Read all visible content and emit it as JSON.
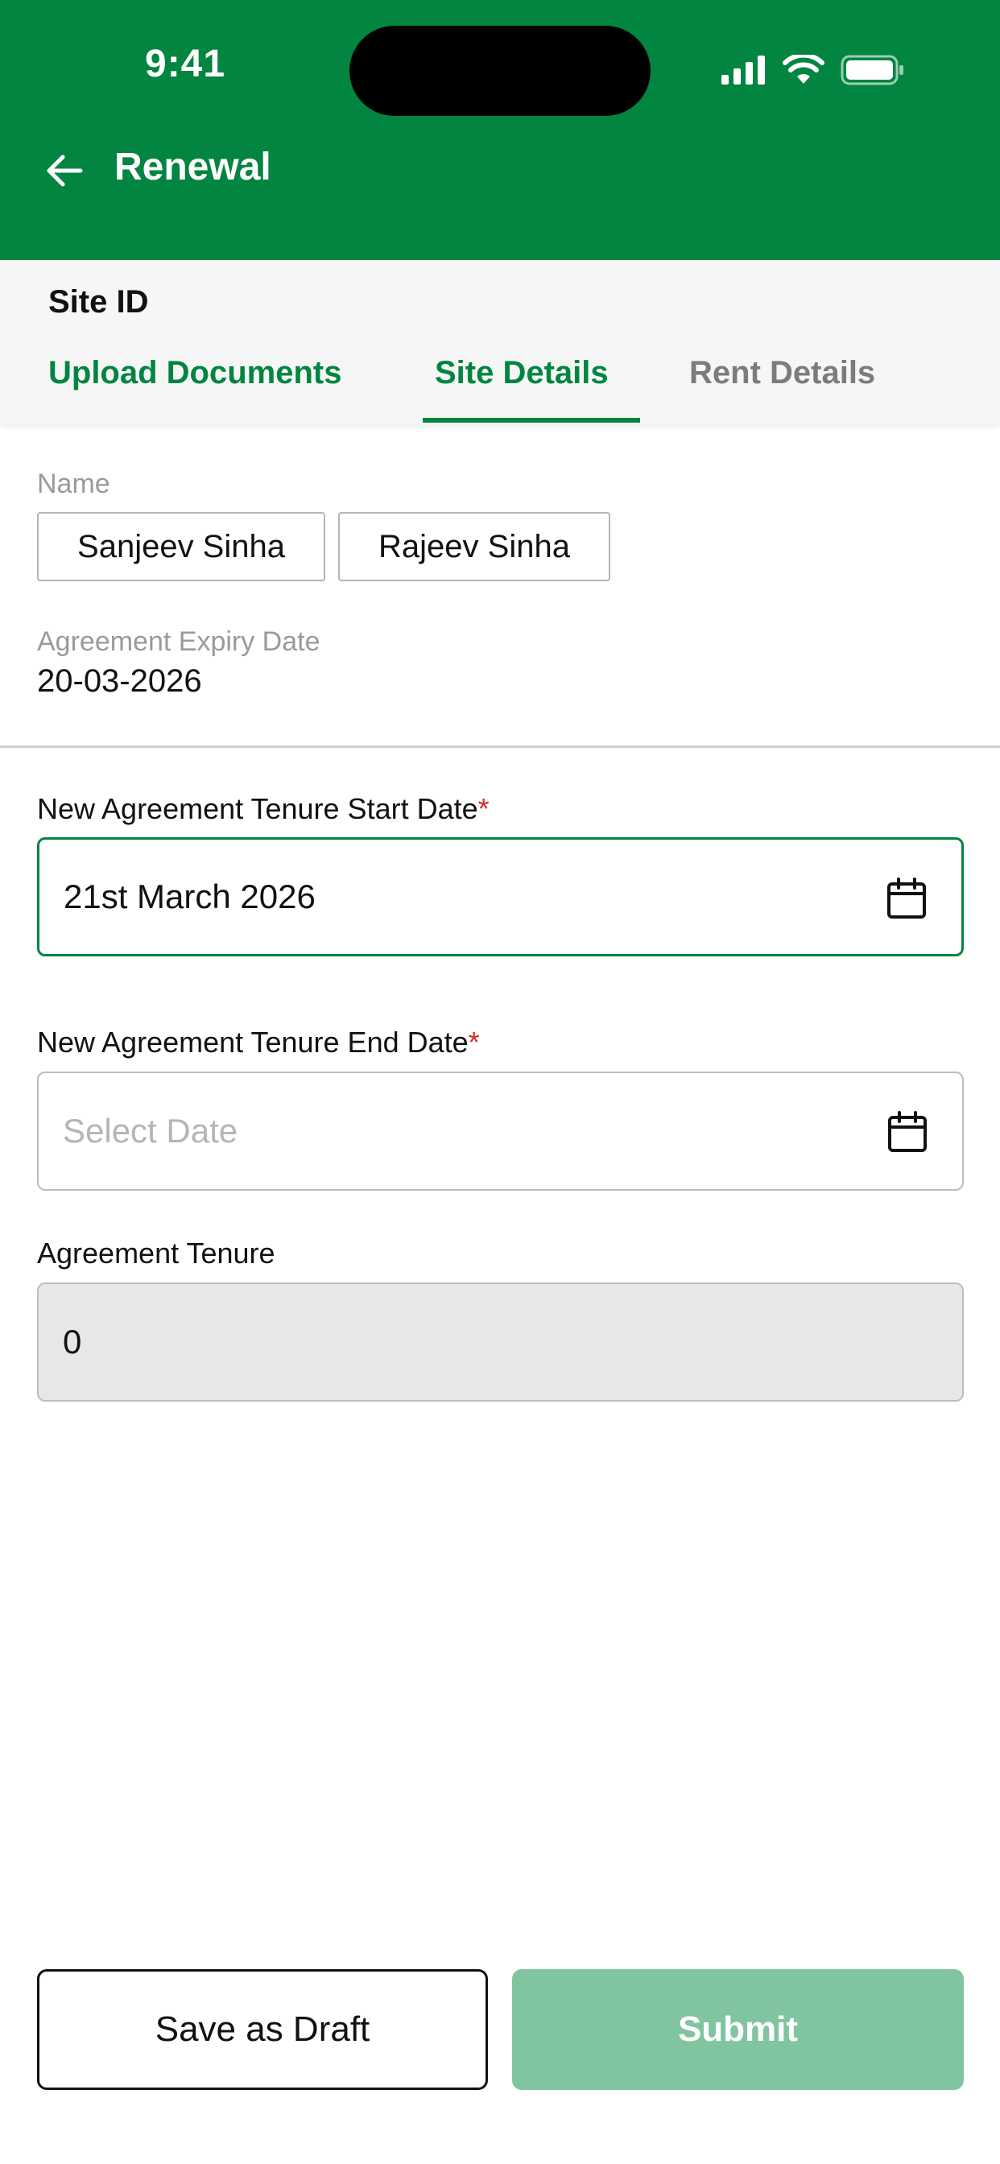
{
  "status_bar": {
    "time": "9:41"
  },
  "header": {
    "title": "Renewal"
  },
  "site": {
    "id_label": "Site ID"
  },
  "tabs": [
    {
      "label": "Upload Documents",
      "state": "completed"
    },
    {
      "label": "Site Details",
      "state": "active"
    },
    {
      "label": "Rent Details",
      "state": "inactive"
    }
  ],
  "details": {
    "name_label": "Name",
    "names": [
      "Sanjeev Sinha",
      "Rajeev Sinha"
    ],
    "expiry_label": "Agreement Expiry Date",
    "expiry_value": "20-03-2026"
  },
  "form": {
    "start_date": {
      "label": "New Agreement Tenure Start Date",
      "required_mark": "*",
      "value": "21st March 2026"
    },
    "end_date": {
      "label": "New Agreement Tenure End Date",
      "required_mark": "*",
      "placeholder": "Select Date"
    },
    "tenure": {
      "label": "Agreement Tenure",
      "value": "0"
    }
  },
  "actions": {
    "draft_label": "Save as Draft",
    "submit_label": "Submit"
  },
  "colors": {
    "brand": "#028540",
    "submit_disabled": "#80c59f",
    "required": "#d12a2a"
  },
  "icons": [
    "back-arrow-icon",
    "signal-icon",
    "wifi-icon",
    "battery-icon",
    "calendar-icon"
  ]
}
